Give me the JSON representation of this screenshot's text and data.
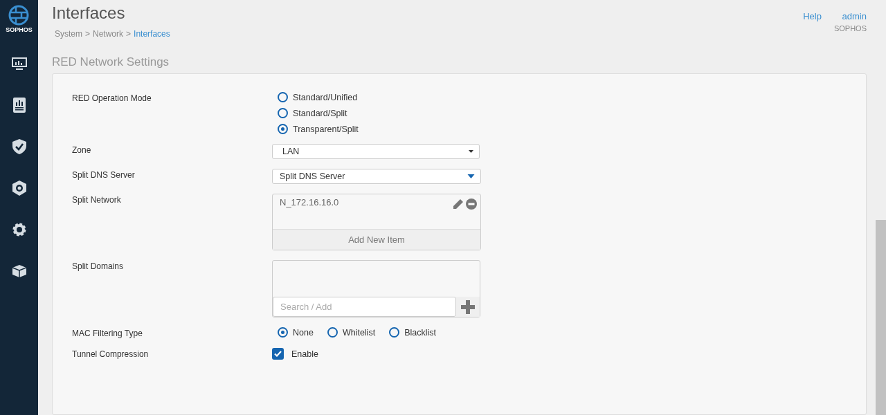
{
  "sidebar": {
    "logo_text": "SOPHOS",
    "items": [
      {
        "kind": "monitor",
        "selected": false
      },
      {
        "kind": "report",
        "selected": false
      },
      {
        "kind": "shield",
        "selected": false
      },
      {
        "kind": "gear-shield",
        "selected": false
      },
      {
        "kind": "gear",
        "selected": false
      },
      {
        "kind": "box",
        "selected": false
      }
    ]
  },
  "header": {
    "title": "Interfaces",
    "breadcrumb": [
      {
        "label": "System",
        "current": false
      },
      {
        "label": "Network",
        "current": false
      },
      {
        "label": "Interfaces",
        "current": true
      }
    ],
    "separator": ">",
    "help": "Help",
    "user": "admin",
    "user_sub": "SOPHOS"
  },
  "section_title": "RED Network Settings",
  "fields": [
    {
      "kind": "radio-stack",
      "label": "RED Operation Mode",
      "options": [
        {
          "label": "Standard/Unified",
          "selected": false
        },
        {
          "label": "Standard/Split",
          "selected": false
        },
        {
          "label": "Transparent/Split",
          "selected": true
        }
      ]
    },
    {
      "kind": "select",
      "label": "Zone",
      "value": "LAN"
    },
    {
      "kind": "combo",
      "label": "Split DNS Server",
      "value": "Split DNS Server"
    },
    {
      "kind": "list",
      "label": "Split Network",
      "items": [
        "N_172.16.16.0"
      ],
      "add_label": "Add New Item"
    },
    {
      "kind": "search-list",
      "label": "Split Domains",
      "placeholder": "Search / Add"
    },
    {
      "kind": "radio-row",
      "label": "MAC Filtering Type",
      "options": [
        {
          "label": "None",
          "selected": true
        },
        {
          "label": "Whitelist",
          "selected": false
        },
        {
          "label": "Blacklist",
          "selected": false
        }
      ]
    },
    {
      "kind": "checkbox",
      "label": "Tunnel Compression",
      "text": "Enable",
      "checked": true
    }
  ]
}
